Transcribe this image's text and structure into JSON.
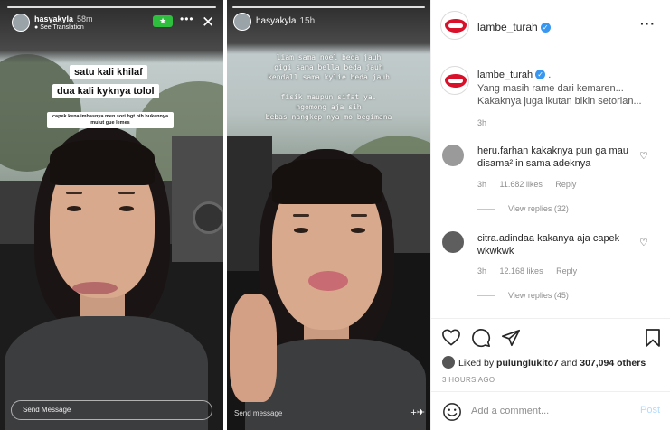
{
  "story_left": {
    "username": "hasyakyla",
    "time": "58m",
    "see_translation": "See Translation",
    "caption_line1": "satu kali khilaf",
    "caption_line2": "dua kali kyknya tolol",
    "small_text": "capek kena imbasnya men sori bgt nih bukannya mulut gue lemes",
    "send_message": "Send Message"
  },
  "story_right": {
    "username": "hasyakyla",
    "time": "15h",
    "lines": [
      "liam sama noel beda jauh",
      "gigi sama bella beda jauh",
      "kendall sama kylie beda jauh"
    ],
    "lines2": [
      "fisik maupun sifat ya.",
      "ngomong aja sih",
      "bebas nangkep nya mo begimana"
    ],
    "send_message": "Send message"
  },
  "post": {
    "author": "lambe_turah",
    "caption_author": "lambe_turah",
    "caption_text": "Yang masih rame dari kemaren... Kakaknya juga ikutan bikin setorian...",
    "caption_time": "3h",
    "comments": [
      {
        "user": "heru.farhan",
        "text": "kakaknya pun ga mau disama² in sama adeknya",
        "time": "3h",
        "likes": "11.682 likes",
        "reply": "Reply",
        "view_replies": "View replies (32)"
      },
      {
        "user": "citra.adindaa",
        "text": "kakanya aja capek wkwkwk",
        "time": "3h",
        "likes": "12.168 likes",
        "reply": "Reply",
        "view_replies": "View replies (45)"
      }
    ],
    "liked_by_prefix": "Liked by",
    "liked_by_user": "pulunglukito7",
    "liked_by_and": "and",
    "liked_by_count": "307,094 others",
    "time_ago": "3 HOURS AGO",
    "add_comment_placeholder": "Add a comment...",
    "post_button": "Post"
  },
  "icons": {
    "heart": "heart-icon",
    "comment": "comment-icon",
    "share": "share-icon",
    "save": "bookmark-icon",
    "emoji": "smiley-icon",
    "more": "more-options-icon",
    "close": "close-icon",
    "verified": "verified-badge-icon"
  },
  "colors": {
    "verified_blue": "#3897f0",
    "brand_red": "#d8102a",
    "star_green": "#2fbf3e",
    "post_disabled": "#b3dbff"
  }
}
